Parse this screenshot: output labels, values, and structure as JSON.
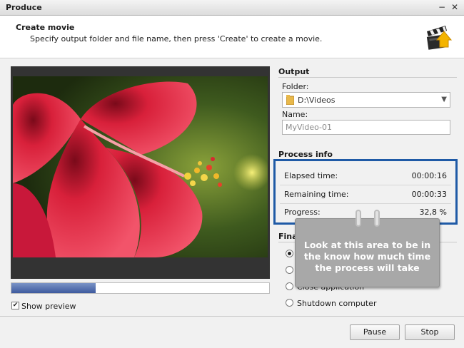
{
  "window": {
    "title": "Produce",
    "minimize_glyph": "−",
    "close_glyph": "✕"
  },
  "header": {
    "title": "Create movie",
    "subtitle": "Specify output folder and file name, then press 'Create' to create a movie.",
    "icon": "clapperboard-icon"
  },
  "preview": {
    "progress": 0.328,
    "show_preview_label": "Show preview",
    "show_preview_checked": true
  },
  "output": {
    "section_title": "Output",
    "folder_label": "Folder:",
    "folder_value": "D:\\Videos",
    "name_label": "Name:",
    "name_value": "MyVideo-01"
  },
  "process_info": {
    "section_title": "Process info",
    "elapsed_label": "Elapsed time:",
    "elapsed_value": "00:00:16",
    "remaining_label": "Remaining time:",
    "remaining_value": "00:00:33",
    "progress_label": "Progress:",
    "progress_value": "32,8 %",
    "highlight_color": "#1f5aa6"
  },
  "final": {
    "section_title_partial": "Final",
    "options": [
      {
        "label": "",
        "selected": true
      },
      {
        "label": "",
        "selected": false
      },
      {
        "label": "Close application",
        "selected": false
      },
      {
        "label": "Shutdown computer",
        "selected": false
      }
    ]
  },
  "callout": {
    "text": "Look at this area to be in the know how much time the process will take"
  },
  "buttons": {
    "pause": "Pause",
    "stop": "Stop"
  }
}
